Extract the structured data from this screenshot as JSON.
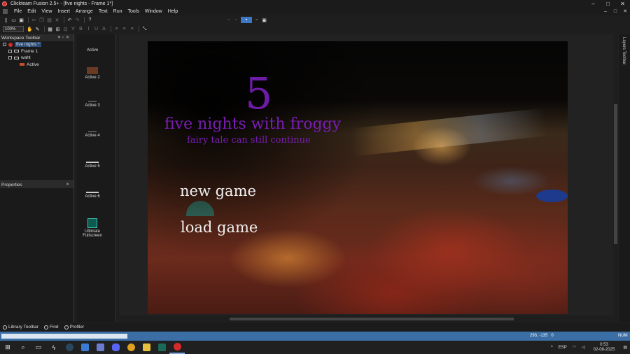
{
  "window": {
    "title": "Clickteam Fusion 2.5+ - [five nights - Frame 1*]",
    "controls": [
      "–",
      "□",
      "✕"
    ]
  },
  "menu": {
    "items": [
      "File",
      "Edit",
      "View",
      "Insert",
      "Arrange",
      "Text",
      "Run",
      "Tools",
      "Window",
      "Help"
    ],
    "mdi_controls": [
      "–",
      "□",
      "✕"
    ]
  },
  "toolbar": {
    "zoom": "100%",
    "bold": "B",
    "italic": "I",
    "underline": "U",
    "help": "?"
  },
  "workspace": {
    "title": "Workspace Toolbar",
    "tree": [
      {
        "label": "five nights *",
        "level": 0
      },
      {
        "label": "Frame 1",
        "level": 1
      },
      {
        "label": "waht",
        "level": 1
      },
      {
        "label": "Active",
        "level": 2
      }
    ]
  },
  "properties": {
    "title": "Properties"
  },
  "bottom_tabs": {
    "library": "Library Toolbar",
    "find": "Find",
    "profiler": "Profiler"
  },
  "objects": [
    {
      "label": "Active"
    },
    {
      "label": "Active 2"
    },
    {
      "label": "Active 3"
    },
    {
      "label": "Active 4"
    },
    {
      "label": "Active 5"
    },
    {
      "label": "Active 6"
    },
    {
      "label": "Ultimate Fullscreen"
    }
  ],
  "scene": {
    "number": "5",
    "title": "five nights with froggy",
    "subtitle": "fairy tale can still continue",
    "menu_new": "new game",
    "menu_load": "load game"
  },
  "layers": {
    "label": "Layers Toolbar"
  },
  "status": {
    "coords": "293, -135",
    "count": "0",
    "num": "NUM"
  },
  "taskbar": {
    "lang": "ESP",
    "time": "0:53",
    "date": "02-08-2025"
  }
}
